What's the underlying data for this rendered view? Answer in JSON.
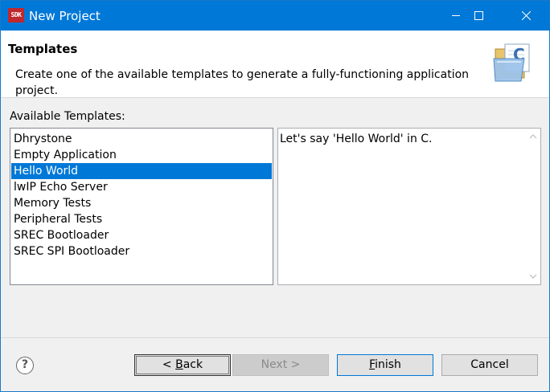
{
  "window": {
    "title": "New Project",
    "app_icon_text": "SDK"
  },
  "banner": {
    "title": "Templates",
    "description": "Create one of the available templates to generate a fully-functioning application project."
  },
  "templates": {
    "label": "Available Templates:",
    "items": [
      "Dhrystone",
      "Empty Application",
      "Hello World",
      "lwIP Echo Server",
      "Memory Tests",
      "Peripheral Tests",
      "SREC Bootloader",
      "SREC SPI Bootloader"
    ],
    "selected_index": 2,
    "selected": "Hello World"
  },
  "description_panel": {
    "text": "Let's say 'Hello World' in C."
  },
  "buttons": {
    "back": "< Back",
    "next": "Next >",
    "finish": "Finish",
    "cancel": "Cancel",
    "help": "?"
  },
  "colors": {
    "titlebar": "#0078d7",
    "selection": "#0078d7",
    "app_icon": "#c0282e"
  }
}
